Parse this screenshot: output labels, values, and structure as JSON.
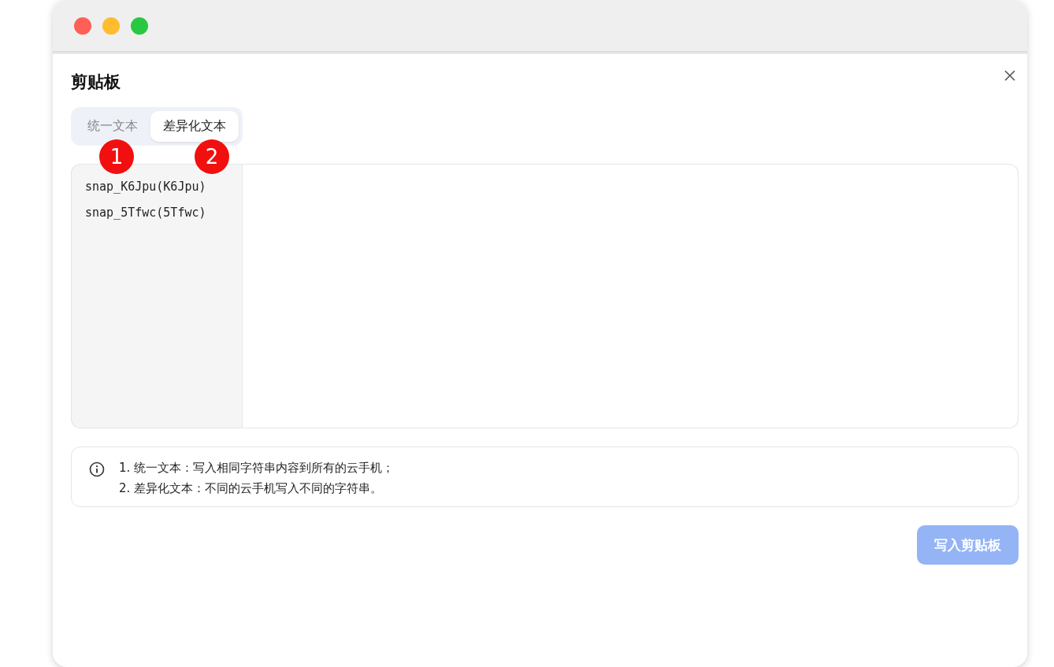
{
  "window": {
    "controls": [
      {
        "color": "#fe5f57"
      },
      {
        "color": "#febc2e"
      },
      {
        "color": "#28c840"
      }
    ]
  },
  "dialog": {
    "title": "剪贴板"
  },
  "tabs": [
    {
      "label": "统一文本",
      "selected": false
    },
    {
      "label": "差异化文本",
      "selected": true
    }
  ],
  "annotations": [
    "1",
    "2"
  ],
  "devices": [
    "snap_K6Jpu(K6Jpu)",
    "snap_5Tfwc(5Tfwc)"
  ],
  "info": [
    "1. 统一文本：写入相同字符串内容到所有的云手机；",
    "2. 差异化文本：不同的云手机写入不同的字符串。"
  ],
  "submit": {
    "label": "写入剪贴板",
    "disabled": true
  }
}
